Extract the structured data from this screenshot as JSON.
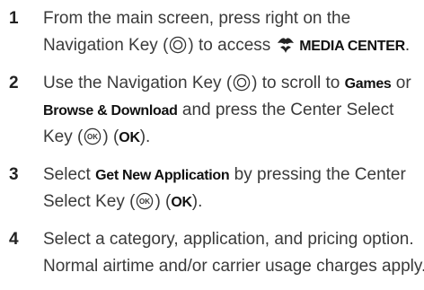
{
  "steps": [
    {
      "number": "1",
      "line1": "From the main screen, press right on the",
      "line2_pre": "Navigation Key (",
      "line2_mid": ") to access",
      "media_label": "MEDIA CENTER",
      "line2_end": "."
    },
    {
      "number": "2",
      "line1_pre": "Use the Navigation Key (",
      "line1_mid": ") to scroll to ",
      "games_label": "Games",
      "line1_or": " or",
      "browse_label": "Browse & Download",
      "line2_rest": " and press the Center Select",
      "line3_pre": "Key (",
      "line3_mid": ") (",
      "ok_label": "OK",
      "line3_end": ")."
    },
    {
      "number": "3",
      "line1_pre": "Select ",
      "app_label": "Get New Application",
      "line1_rest": " by pressing the Center",
      "line2_pre": "Select Key (",
      "line2_mid": ") (",
      "ok_label": "OK",
      "line2_end": ")."
    },
    {
      "number": "4",
      "line1": "Select a category, application, and pricing option.",
      "line2": "Normal airtime and/or carrier usage charges apply."
    }
  ],
  "icons": {
    "navigation_key": "navigation-key-icon",
    "center_select_key": "center-select-key-icon",
    "media_center": "media-center-icon"
  },
  "colors": {
    "text": "#3a3a3a",
    "number": "#222222",
    "ui_label": "#111111"
  }
}
